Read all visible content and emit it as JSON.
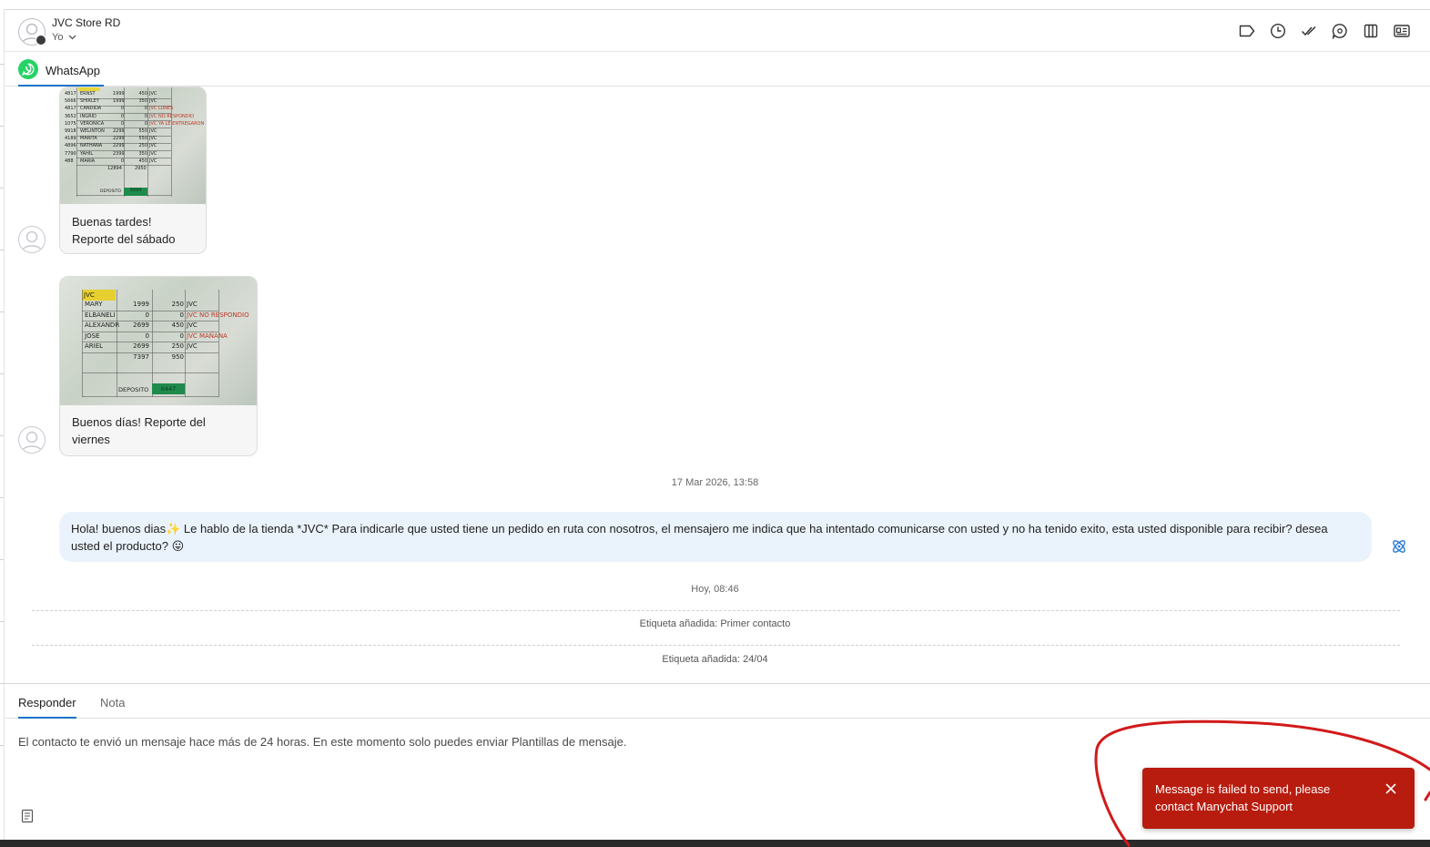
{
  "header": {
    "contact_name": "JVC Store RD",
    "assignee": "Yo",
    "actions": [
      "tag-icon",
      "snooze-icon",
      "check-icon",
      "chat-bubble-icon",
      "columns-icon",
      "contact-card-icon"
    ]
  },
  "channel": {
    "label": "WhatsApp",
    "icon": "whatsapp-icon",
    "color": "#25d366"
  },
  "messages": {
    "msg1": {
      "text": "Buenas tardes!\nReporte del sábado",
      "sheet": {
        "rows": [
          [
            "4817",
            "ERNST",
            "1999",
            "450",
            "JVC"
          ],
          [
            "5666",
            "SHIRLEY",
            "1999",
            "350",
            "JVC"
          ],
          [
            "4817",
            "CANDIDA",
            "0",
            "0",
            "JVC LUNES"
          ],
          [
            "3652",
            "INGRID",
            "0",
            "0",
            "JVC NO RESPONDIO"
          ],
          [
            "1075",
            "VERONICA",
            "0",
            "0",
            "JVC YA LE ENTREGARON"
          ],
          [
            "9918",
            "WELINTON",
            "2299",
            "550",
            "JVC"
          ],
          [
            "4189",
            "MARITA",
            "2299",
            "550",
            "JVC"
          ],
          [
            "4896",
            "NATHANA",
            "2299",
            "250",
            "JVC"
          ],
          [
            "7790",
            "YAHIL",
            "2399",
            "350",
            "JVC"
          ],
          [
            "488",
            "MARIA",
            "0",
            "450",
            "JVC"
          ]
        ],
        "total_left": "12894",
        "total_right": "2950",
        "deposit_label": "DEPOSITO",
        "deposit_value": "9994"
      }
    },
    "msg2": {
      "text": "Buenos días! Reporte del\nviernes",
      "sheet": {
        "header": "JVC",
        "rows": [
          [
            "MARY",
            "1999",
            "250",
            "JVC"
          ],
          [
            "ELBANELI",
            "0",
            "0",
            "JVC NO RESPONDIO"
          ],
          [
            "ALEXANDR",
            "2699",
            "450",
            "JVC"
          ],
          [
            "JOSE",
            "0",
            "0",
            "JVC MAÑANA"
          ],
          [
            "ARIEL",
            "2699",
            "250",
            "JVC"
          ]
        ],
        "total_left": "7397",
        "total_right": "950",
        "deposit_label": "DEPOSITO",
        "deposit_value": "6447"
      }
    },
    "date1": "17 Mar 2026, 13:58",
    "outgoing": "Hola! buenos dias✨ Le hablo de la tienda *JVC* Para indicarle que usted tiene un pedido en ruta con nosotros, el mensajero me indica que ha intentado comunicarse con usted y no ha tenido exito, esta usted disponible para recibir? desea usted el producto? 😛",
    "date2": "Hoy, 08:46",
    "event1": "Etiqueta añadida: Primer contacto",
    "event2": "Etiqueta añadida: 24/04"
  },
  "composer": {
    "tab_reply": "Responder",
    "tab_note": "Nota",
    "note": "El contacto te envió un mensaje hace más de 24 horas. En este momento solo puedes enviar Plantillas de mensaje."
  },
  "toast": {
    "message": "Message is failed to send, please contact Manychat Support",
    "color": "#b81c0f"
  },
  "colors": {
    "accent": "#1a73c9",
    "outgoing_bubble": "#eaf3fb",
    "annotation": "#d11a1a"
  }
}
